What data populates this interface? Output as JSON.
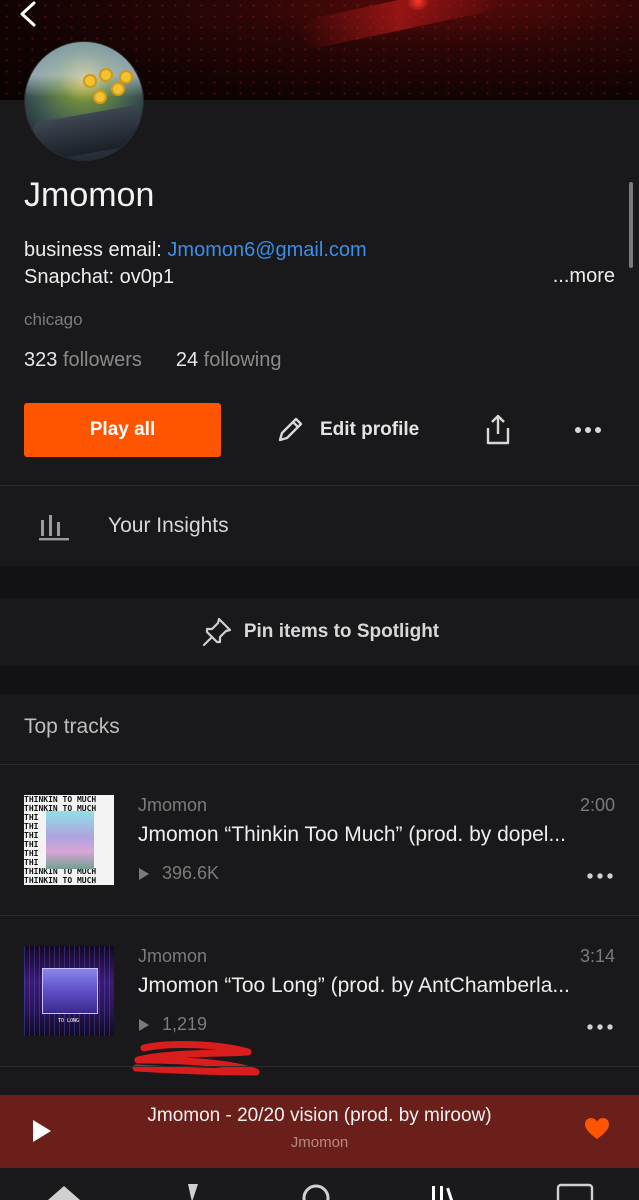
{
  "profile": {
    "name": "Jmomon",
    "bio_line1_prefix": "business email: ",
    "bio_email": "Jmomon6@gmail.com",
    "bio_line2": "Snapchat: ov0p1",
    "more_label": "...more",
    "location": "chicago",
    "followers_count": "323",
    "followers_label": "followers",
    "following_count": "24",
    "following_label": "following"
  },
  "actions": {
    "play_all": "Play all",
    "edit_profile": "Edit profile"
  },
  "insights": {
    "label": "Your Insights"
  },
  "spotlight": {
    "label": "Pin items to Spotlight"
  },
  "top_tracks": {
    "title": "Top tracks",
    "tracks": [
      {
        "artist": "Jmomon",
        "duration": "2:00",
        "title": "Jmomon “Thinkin Too Much” (prod. by dopel...",
        "plays": "396.6K",
        "art_text": "THINKIN TO MUCH"
      },
      {
        "artist": "Jmomon",
        "duration": "3:14",
        "title": "Jmomon “Too Long” (prod. by AntChamberla...",
        "plays": "1,219",
        "art_text": "TO LONG"
      }
    ]
  },
  "now_playing": {
    "title": "Jmomon - 20/20 vision (prod. by miroow)",
    "artist": "Jmomon",
    "liked": true
  },
  "colors": {
    "accent": "#ff5500",
    "link": "#3b8ee8",
    "now_playing_bg": "#6b1f1a",
    "background": "#19191b"
  },
  "icons": [
    "back-icon",
    "pencil-icon",
    "share-icon",
    "more-icon",
    "bar-chart-icon",
    "pin-icon",
    "play-icon",
    "heart-icon",
    "home-icon",
    "lightning-icon",
    "search-icon",
    "library-icon",
    "go-icon"
  ]
}
